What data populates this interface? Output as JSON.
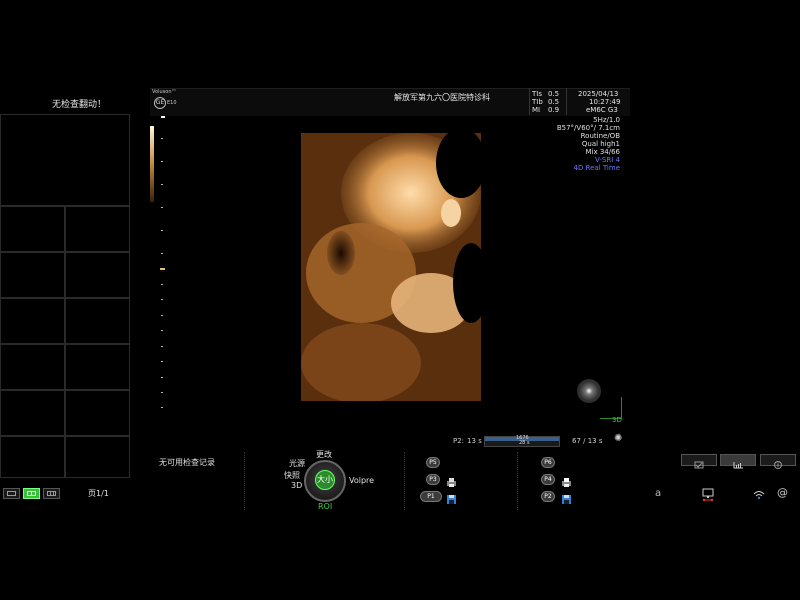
{
  "left_panel": {
    "title": "无检查翻动！",
    "page_label": "页1/1"
  },
  "header": {
    "logo": "Voluson E10 GE",
    "logo_line1": "Voluson™",
    "logo_line2": "E10",
    "hospital": "解放军第九六〇医院特诊科",
    "tis_label": "TIs",
    "tis_value": "0.5",
    "tib_label": "TIb",
    "tib_value": "0.5",
    "mi_label": "MI",
    "mi_value": "0.9",
    "date": "2025/04/13",
    "time": "10:27:49",
    "probe": "eM6C G3"
  },
  "right_info": {
    "line1": "5Hz/1.0",
    "line2": "B57°/V60°/ 7.1cm",
    "line3": "Routine/OB",
    "line4": "Qual high1",
    "line5": "Mix 34/66",
    "line6": "V-SRI 4",
    "line7": "4D Real Time",
    "accent_color": "#6a78ff"
  },
  "orientation": {
    "label": "3D"
  },
  "cine": {
    "p2_label": "P2:",
    "p2_time": "13 s",
    "bar_top": "1676",
    "bar_bottom": "28 s",
    "frame": "67 / 13 s"
  },
  "bottom": {
    "status": "无可用检查记录",
    "knob": {
      "top": "更改",
      "left_top": "光源",
      "left_mid": "快照",
      "left_bottom": "3D",
      "center": "大小",
      "right": "Volpre",
      "bottom": "ROI"
    },
    "p_buttons_left": [
      "P5",
      "P3",
      "P1"
    ],
    "p_buttons_right": [
      "P6",
      "P4",
      "P2"
    ],
    "right_letter": "a",
    "accent_green": "#3bbf3b"
  },
  "icons": {
    "sun": "settings-sun-icon",
    "chart": "chart-icon",
    "info": "info-icon"
  }
}
